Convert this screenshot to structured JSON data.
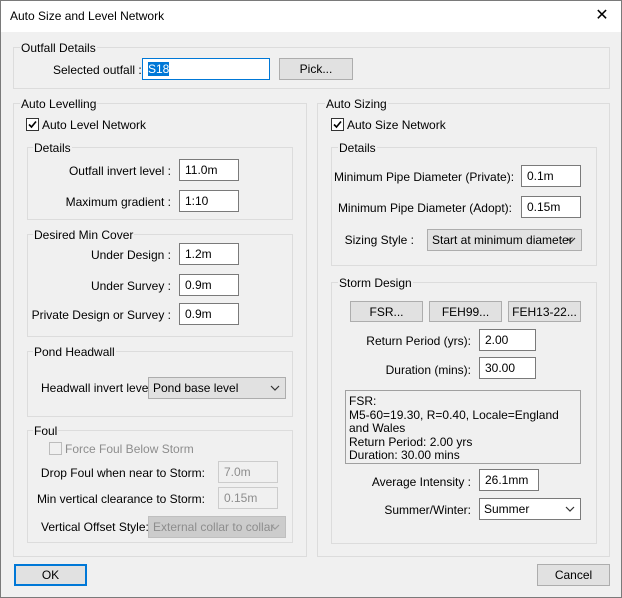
{
  "window": {
    "title": "Auto Size and Level Network",
    "close_glyph": "✕"
  },
  "outfall": {
    "group_label": "Outfall Details",
    "selected_label": "Selected outfall :",
    "selected_value": "S18",
    "pick_label": "Pick..."
  },
  "auto_levelling": {
    "group_label": "Auto Levelling",
    "checkbox_label": "Auto Level Network",
    "checked": true,
    "details": {
      "group_label": "Details",
      "outfall_invert_label": "Outfall invert level :",
      "outfall_invert_value": "11.0m",
      "max_gradient_label": "Maximum gradient :",
      "max_gradient_value": "1:10"
    },
    "min_cover": {
      "group_label": "Desired Min Cover",
      "under_design_label": "Under Design :",
      "under_design_value": "1.2m",
      "under_survey_label": "Under Survey :",
      "under_survey_value": "0.9m",
      "private_label": "Private Design or Survey :",
      "private_value": "0.9m"
    },
    "pond": {
      "group_label": "Pond Headwall",
      "headwall_label": "Headwall invert level:",
      "headwall_value": "Pond base level"
    },
    "foul": {
      "group_label": "Foul",
      "force_label": "Force Foul Below Storm",
      "drop_label": "Drop Foul when near to Storm:",
      "drop_value": "7.0m",
      "clearance_label": "Min vertical clearance to Storm:",
      "clearance_value": "0.15m",
      "offset_label": "Vertical Offset Style:",
      "offset_value": "External collar to collar"
    }
  },
  "auto_sizing": {
    "group_label": "Auto Sizing",
    "checkbox_label": "Auto Size Network",
    "checked": true,
    "details": {
      "group_label": "Details",
      "min_private_label": "Minimum Pipe Diameter (Private):",
      "min_private_value": "0.1m",
      "min_adopt_label": "Minimum Pipe Diameter (Adopt):",
      "min_adopt_value": "0.15m",
      "sizing_style_label": "Sizing Style :",
      "sizing_style_value": "Start at minimum diameter"
    },
    "storm": {
      "group_label": "Storm Design",
      "fsr_label": "FSR...",
      "feh99_label": "FEH99...",
      "feh13_label": "FEH13-22...",
      "return_label": "Return Period (yrs):",
      "return_value": "2.00",
      "duration_label": "Duration (mins):",
      "duration_value": "30.00",
      "info_text": "FSR:\nM5-60=19.30, R=0.40, Locale=England and Wales\nReturn Period: 2.00 yrs\nDuration: 30.00 mins",
      "intensity_label": "Average Intensity :",
      "intensity_value": "26.1mm",
      "season_label": "Summer/Winter:",
      "season_value": "Summer"
    }
  },
  "footer": {
    "ok_label": "OK",
    "cancel_label": "Cancel"
  }
}
